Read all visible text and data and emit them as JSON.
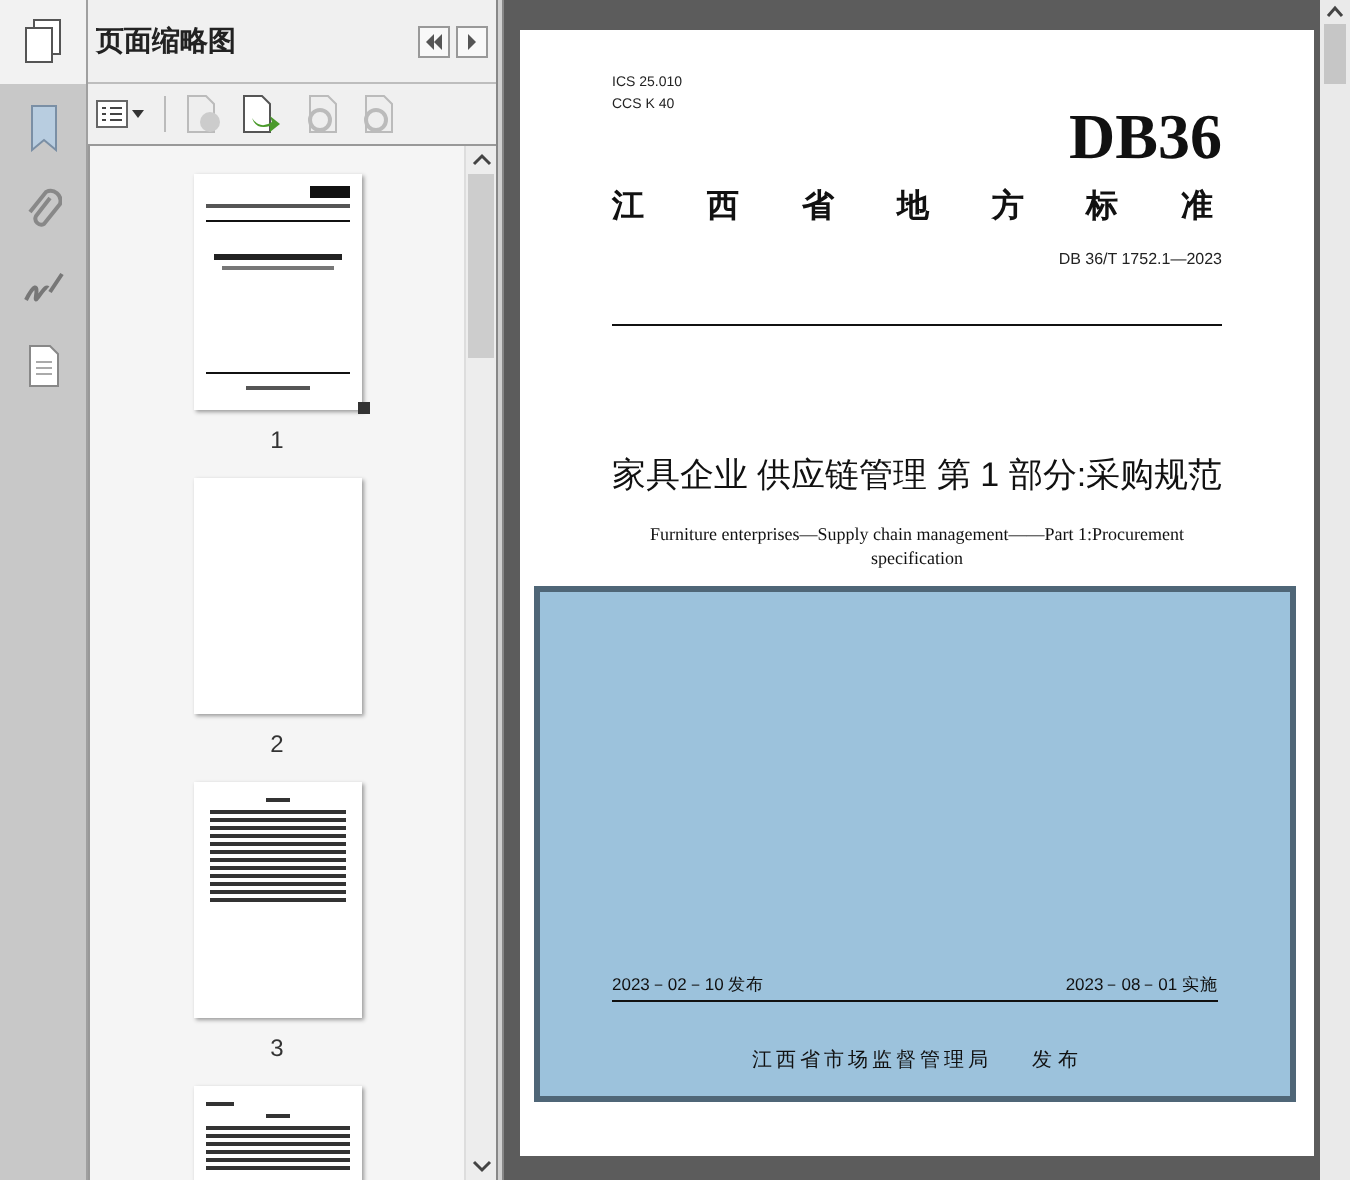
{
  "panel": {
    "title": "页面缩略图"
  },
  "thumbnails": [
    {
      "page": "1",
      "kind": "cover"
    },
    {
      "page": "2",
      "kind": "blank"
    },
    {
      "page": "3",
      "kind": "contents"
    },
    {
      "kind": "text"
    }
  ],
  "document": {
    "ics": "ICS 25.010",
    "ccs": "CCS K 40",
    "code": "DB36",
    "category": "江 西 省 地 方 标 准",
    "number": "DB 36/T 1752.1—2023",
    "title": "家具企业 供应链管理 第 1 部分:采购规范",
    "subtitle": "Furniture enterprises—Supply chain management——Part 1:Procurement specification",
    "issued": "2023－02－10 发布",
    "effective": "2023－08－01 实施",
    "publisher": "江西省市场监督管理局",
    "publish_label": "发 布"
  }
}
